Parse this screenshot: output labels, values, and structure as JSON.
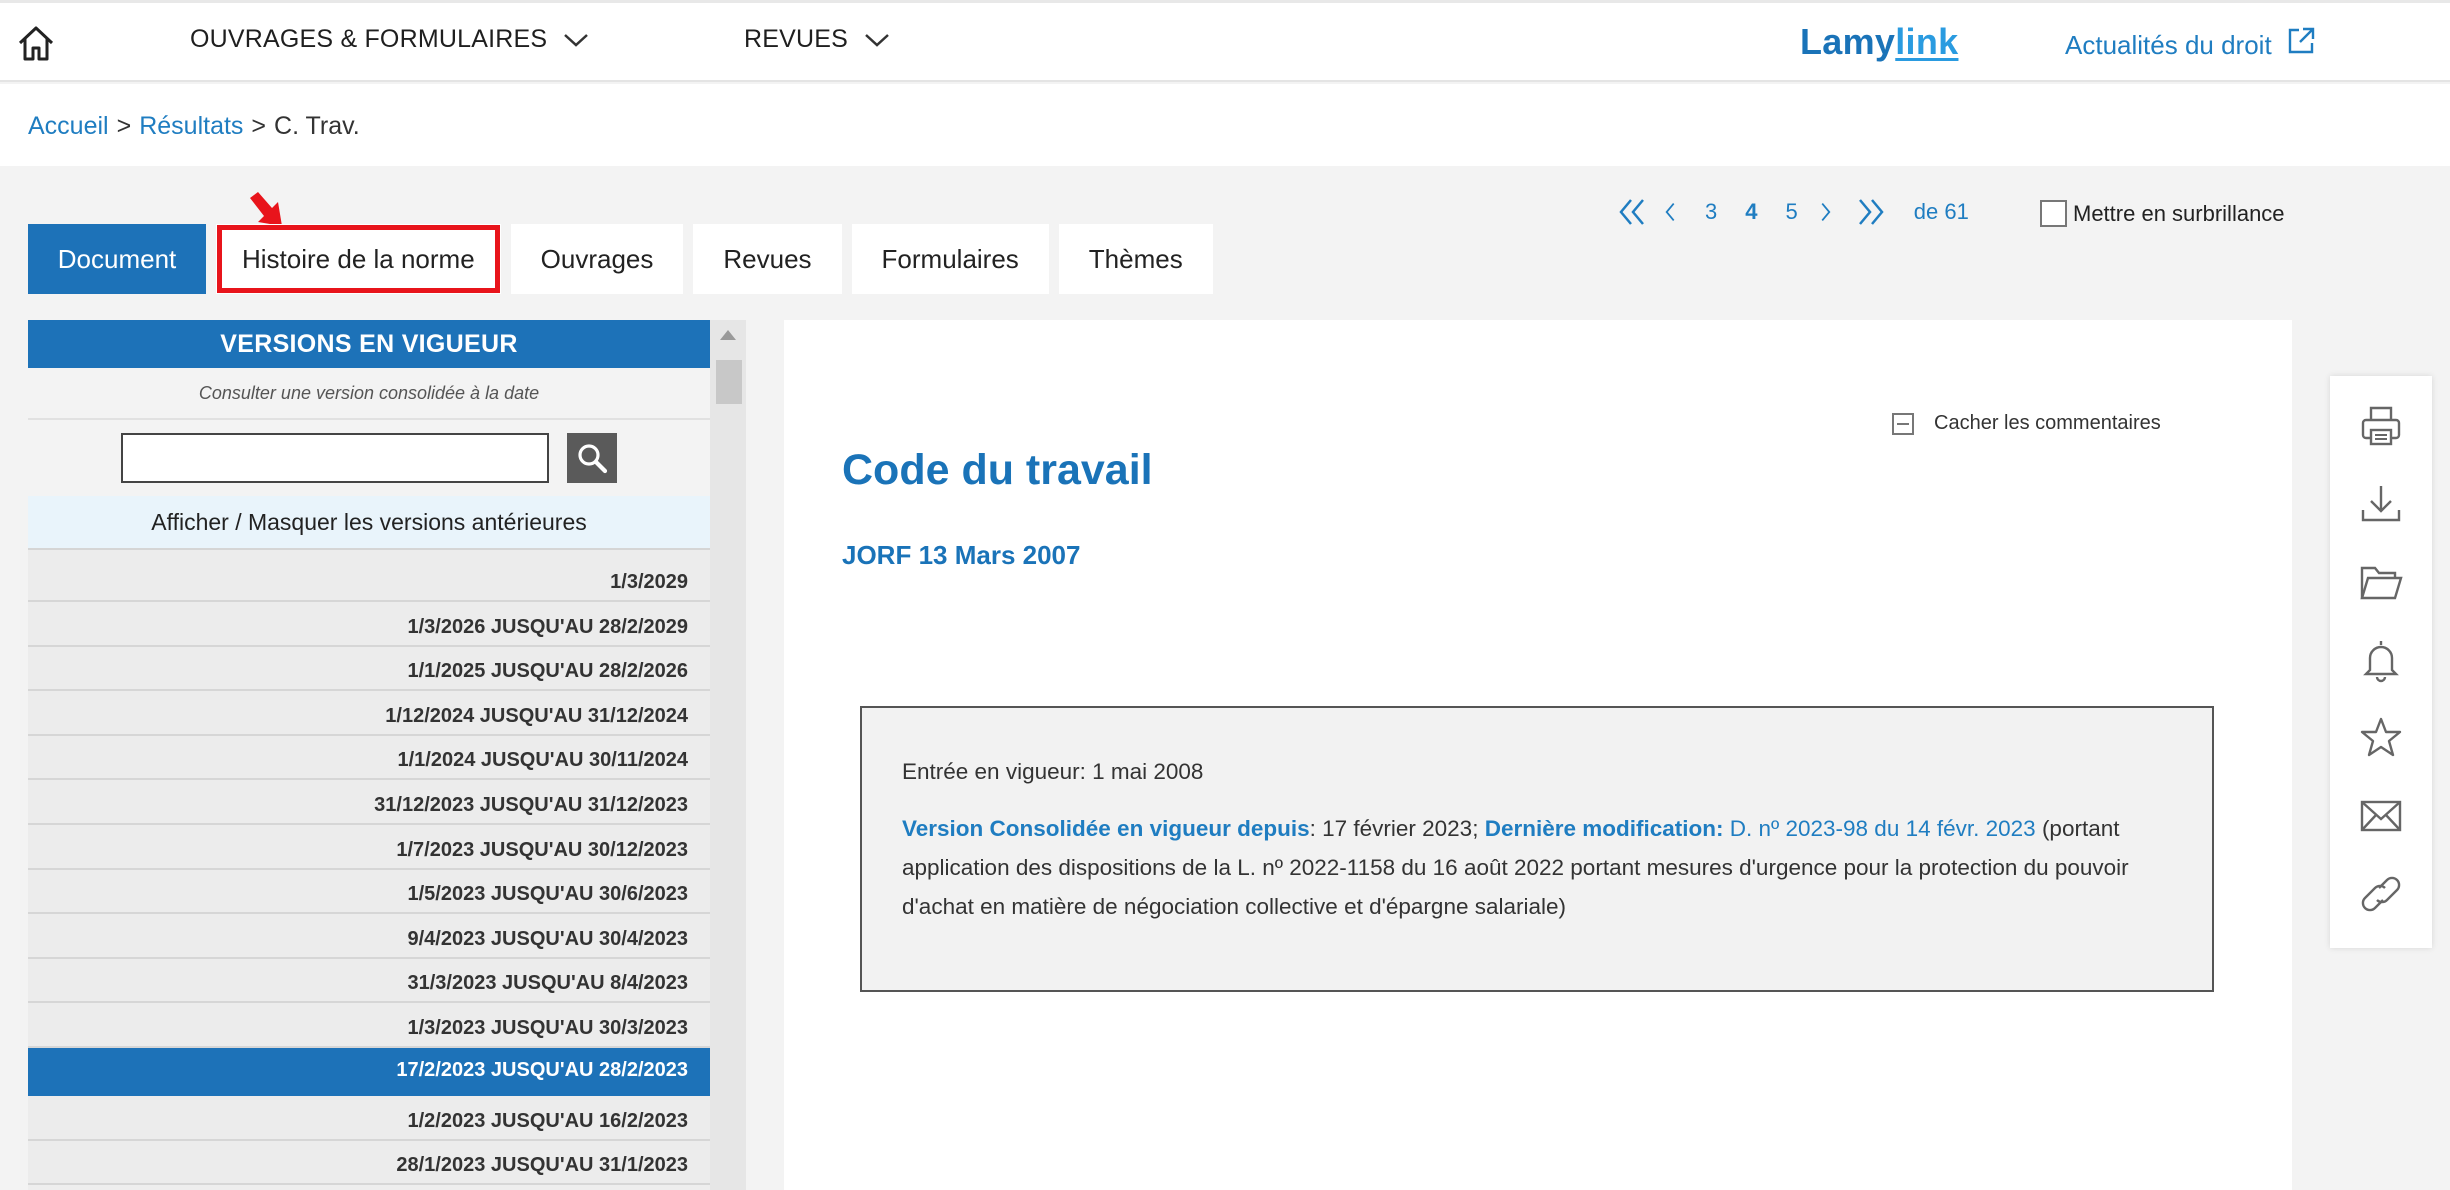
{
  "topbar": {
    "nav": [
      {
        "label": "OUVRAGES & FORMULAIRES"
      },
      {
        "label": "REVUES"
      }
    ],
    "brand_a": "Lamy",
    "brand_b": "link",
    "news_link": "Actualités du droit"
  },
  "breadcrumb": {
    "home": "Accueil",
    "sep1": ">",
    "results": "Résultats",
    "sep2": ">",
    "current": "C. Trav."
  },
  "tabs": [
    {
      "label": "Document"
    },
    {
      "label": "Histoire de la norme"
    },
    {
      "label": "Ouvrages"
    },
    {
      "label": "Revues"
    },
    {
      "label": "Formulaires"
    },
    {
      "label": "Thèmes"
    }
  ],
  "pagination": {
    "pages": [
      "3",
      "4",
      "5"
    ],
    "current": "4",
    "total": "de 61"
  },
  "highlight_label": "Mettre en surbrillance",
  "versions": {
    "header": "VERSIONS EN VIGUEUR",
    "consult_label": "Consulter une version consolidée à la date",
    "date_value": "",
    "toggle_label": "Afficher / Masquer les versions antérieures",
    "items": [
      "1/3/2029",
      "1/3/2026 JUSQU'AU 28/2/2029",
      "1/1/2025 JUSQU'AU 28/2/2026",
      "1/12/2024 JUSQU'AU 31/12/2024",
      "1/1/2024 JUSQU'AU 30/11/2024",
      "31/12/2023 JUSQU'AU 31/12/2023",
      "1/7/2023 JUSQU'AU 30/12/2023",
      "1/5/2023 JUSQU'AU 30/6/2023",
      "9/4/2023 JUSQU'AU 30/4/2023",
      "31/3/2023 JUSQU'AU 8/4/2023",
      "1/3/2023 JUSQU'AU 30/3/2023",
      "17/2/2023 JUSQU'AU 28/2/2023",
      "1/2/2023 JUSQU'AU 16/2/2023",
      "28/1/2023 JUSQU'AU 31/1/2023"
    ],
    "selected_index": 11
  },
  "document": {
    "hide_comments": "Cacher les commentaires",
    "title": "Code du travail",
    "subtitle": "JORF 13 Mars 2007",
    "entry": "Entrée en vigueur: 1 mai 2008",
    "consolidated_label": "Version Consolidée en vigueur depuis",
    "consolidated_value": ": 17 février 2023; ",
    "last_mod_label": "Dernière modification:",
    "last_mod_link": " D. nº 2023-98 du 14 févr. 2023",
    "last_mod_text": " (portant application des dispositions de la L. nº 2022-1158 du 16 août 2022 portant mesures d'urgence pour la protection du pouvoir d'achat en matière de négociation collective et d'épargne salariale)"
  },
  "tools": [
    "print-icon",
    "download-icon",
    "folder-icon",
    "bell-icon",
    "star-icon",
    "mail-icon",
    "link-icon"
  ],
  "colors": {
    "accent": "#1d72b8",
    "link": "#1f7dc1",
    "highlight_box": "#e8141b"
  }
}
